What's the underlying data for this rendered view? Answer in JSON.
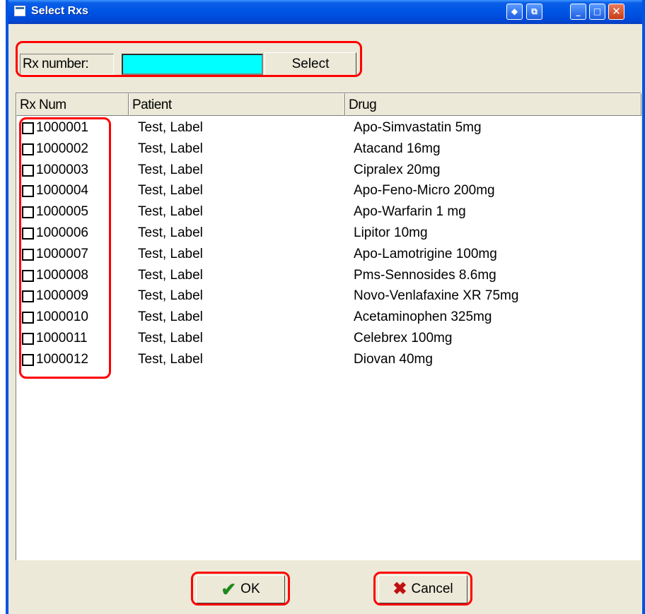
{
  "window": {
    "title": "Select Rxs",
    "controls": {
      "restore": "◆",
      "export": "⧉",
      "minimize": "_",
      "maximize": "□",
      "close": "✕"
    }
  },
  "search": {
    "label": "Rx number:",
    "value": "",
    "button": "Select",
    "input_color": "#00ffff"
  },
  "table": {
    "columns": [
      "Rx Num",
      "Patient",
      "Drug"
    ],
    "rows": [
      {
        "rx": "1000001",
        "patient": "Test, Label",
        "drug": "Apo-Simvastatin 5mg"
      },
      {
        "rx": "1000002",
        "patient": "Test, Label",
        "drug": "Atacand 16mg"
      },
      {
        "rx": "1000003",
        "patient": "Test, Label",
        "drug": "Cipralex 20mg"
      },
      {
        "rx": "1000004",
        "patient": "Test, Label",
        "drug": "Apo-Feno-Micro 200mg"
      },
      {
        "rx": "1000005",
        "patient": "Test, Label",
        "drug": "Apo-Warfarin 1 mg"
      },
      {
        "rx": "1000006",
        "patient": "Test, Label",
        "drug": "Lipitor 10mg"
      },
      {
        "rx": "1000007",
        "patient": "Test, Label",
        "drug": "Apo-Lamotrigine 100mg"
      },
      {
        "rx": "1000008",
        "patient": "Test, Label",
        "drug": "Pms-Sennosides 8.6mg"
      },
      {
        "rx": "1000009",
        "patient": "Test, Label",
        "drug": "Novo-Venlafaxine XR 75mg"
      },
      {
        "rx": "1000010",
        "patient": "Test, Label",
        "drug": "Acetaminophen 325mg"
      },
      {
        "rx": "1000011",
        "patient": "Test, Label",
        "drug": "Celebrex 100mg"
      },
      {
        "rx": "1000012",
        "patient": "Test, Label",
        "drug": "Diovan  40mg"
      }
    ]
  },
  "footer": {
    "ok_label": "OK",
    "cancel_label": "Cancel",
    "ok_icon": "check-icon",
    "cancel_icon": "x-icon"
  },
  "colors": {
    "titlebar": "#0055e5",
    "highlight": "#ff0000",
    "panel": "#ece9d8"
  }
}
